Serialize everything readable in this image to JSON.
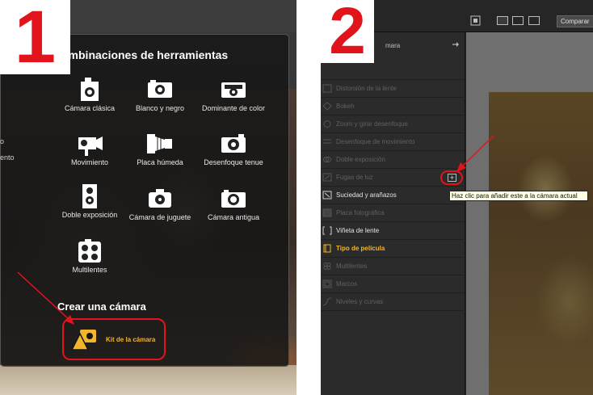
{
  "panel1": {
    "step_number": "1",
    "side_labels": [
      "o",
      "ento"
    ],
    "heading": "ombinaciones de herramientas",
    "tools": [
      {
        "label": "Cámara clásica",
        "icon": "classic-camera-icon"
      },
      {
        "label": "Blanco y negro",
        "icon": "bw-camera-icon"
      },
      {
        "label": "Dominante de color",
        "icon": "color-camera-icon"
      },
      {
        "label": "Movimiento",
        "icon": "movie-camera-icon"
      },
      {
        "label": "Placa húmeda",
        "icon": "bellows-camera-icon"
      },
      {
        "label": "Desenfoque tenue",
        "icon": "soft-focus-camera-icon"
      },
      {
        "label": "Doble exposición",
        "icon": "twin-lens-camera-icon"
      },
      {
        "label": "Cámara de juguete",
        "icon": "toy-camera-icon"
      },
      {
        "label": "Cámara antigua",
        "icon": "vintage-camera-icon"
      },
      {
        "label": "Multilentes",
        "icon": "multilens-camera-icon"
      }
    ],
    "create_heading": "Crear una cámara",
    "kit_label": "Kit de la cámara"
  },
  "panel2": {
    "step_number": "2",
    "header_text": "mara",
    "compare_label": "Comparar",
    "menu_items": [
      {
        "label": "Distorsión de la lente",
        "state": "dim"
      },
      {
        "label": "Bokeh",
        "state": "dim"
      },
      {
        "label": "Zoom y girar desenfoque",
        "state": "dim"
      },
      {
        "label": "Desenfoque de movimiento",
        "state": "dim"
      },
      {
        "label": "Doble exposición",
        "state": "dim"
      },
      {
        "label": "Fugas de luz",
        "state": "dim"
      },
      {
        "label": "Suciedad y arañazos",
        "state": "lit"
      },
      {
        "label": "Placa fotográfica",
        "state": "dim"
      },
      {
        "label": "Viñeta de lente",
        "state": "lit"
      },
      {
        "label": "Tipo de película",
        "state": "active"
      },
      {
        "label": "Multilentes",
        "state": "dim"
      },
      {
        "label": "Marcos",
        "state": "dim"
      },
      {
        "label": "Niveles y curvas",
        "state": "dim"
      }
    ],
    "plus_symbol": "+",
    "tooltip": "Haz clic para añadir este a la cámara actual"
  },
  "colors": {
    "annotation_red": "#e2141b",
    "accent_orange": "#f3b62a",
    "tooltip_bg": "#ffffe1"
  }
}
